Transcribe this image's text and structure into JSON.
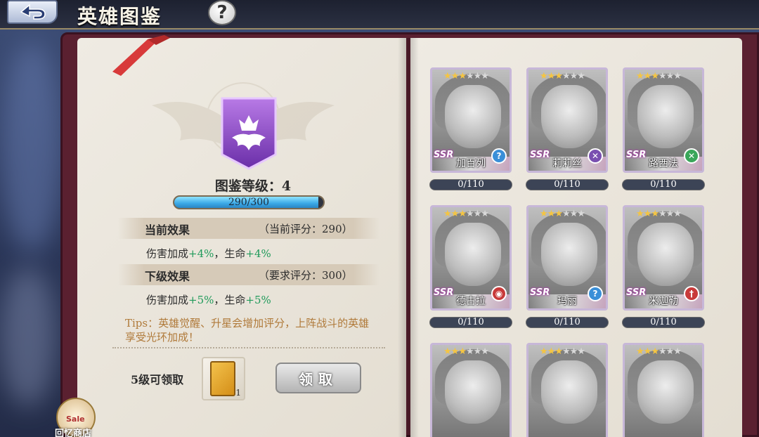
{
  "header": {
    "title": "英雄图鉴",
    "help_label": "?"
  },
  "codex": {
    "level_label": "图鉴等级：",
    "level": "4",
    "progress_text": "290/300",
    "progress_fraction": 0.9667,
    "current_effect": {
      "title": "当前效果",
      "score": "（当前评分：290）",
      "damage_label": "伤害加成",
      "damage_value": "+4%",
      "life_label": "，生命",
      "life_value": "+4%"
    },
    "next_effect": {
      "title": "下级效果",
      "score": "（要求评分：300）",
      "damage_label": "伤害加成",
      "damage_value": "+5%",
      "life_label": "，生命",
      "life_value": "+5%"
    },
    "tips": "Tips：英雄觉醒、升星会增加评分，上阵战斗的英雄享受光环加成！",
    "claim_level_text": "5级可领取",
    "reward_count": "1",
    "claim_button": "领取"
  },
  "shop": {
    "sale_tag": "Sale",
    "label": "回忆商店"
  },
  "heroes": [
    {
      "name": "加百列",
      "rarity": "SSR",
      "stars": 3,
      "role_icon": "question-icon",
      "role_color": "#3a8fd8",
      "progress": "0/110"
    },
    {
      "name": "莉莉丝",
      "rarity": "SSR",
      "stars": 3,
      "role_icon": "swords-icon",
      "role_color": "#7a4fb0",
      "progress": "0/110"
    },
    {
      "name": "路西法",
      "rarity": "SSR",
      "stars": 3,
      "role_icon": "swords-icon",
      "role_color": "#3aa65a",
      "progress": "0/110"
    },
    {
      "name": "德古拉",
      "rarity": "SSR",
      "stars": 3,
      "role_icon": "shield-icon",
      "role_color": "#c83a3a",
      "progress": "0/110"
    },
    {
      "name": "玛丽",
      "rarity": "SSR",
      "stars": 3,
      "role_icon": "question-icon",
      "role_color": "#3a8fd8",
      "progress": "0/110"
    },
    {
      "name": "米迦勒",
      "rarity": "SSR",
      "stars": 3,
      "role_icon": "sword-icon",
      "role_color": "#c83a3a",
      "progress": "0/110"
    },
    {
      "name": "",
      "rarity": "",
      "stars": 3,
      "role_icon": "",
      "role_color": "",
      "progress": ""
    },
    {
      "name": "",
      "rarity": "",
      "stars": 3,
      "role_icon": "",
      "role_color": "",
      "progress": ""
    },
    {
      "name": "",
      "rarity": "",
      "stars": 3,
      "role_icon": "",
      "role_color": "",
      "progress": ""
    }
  ]
}
